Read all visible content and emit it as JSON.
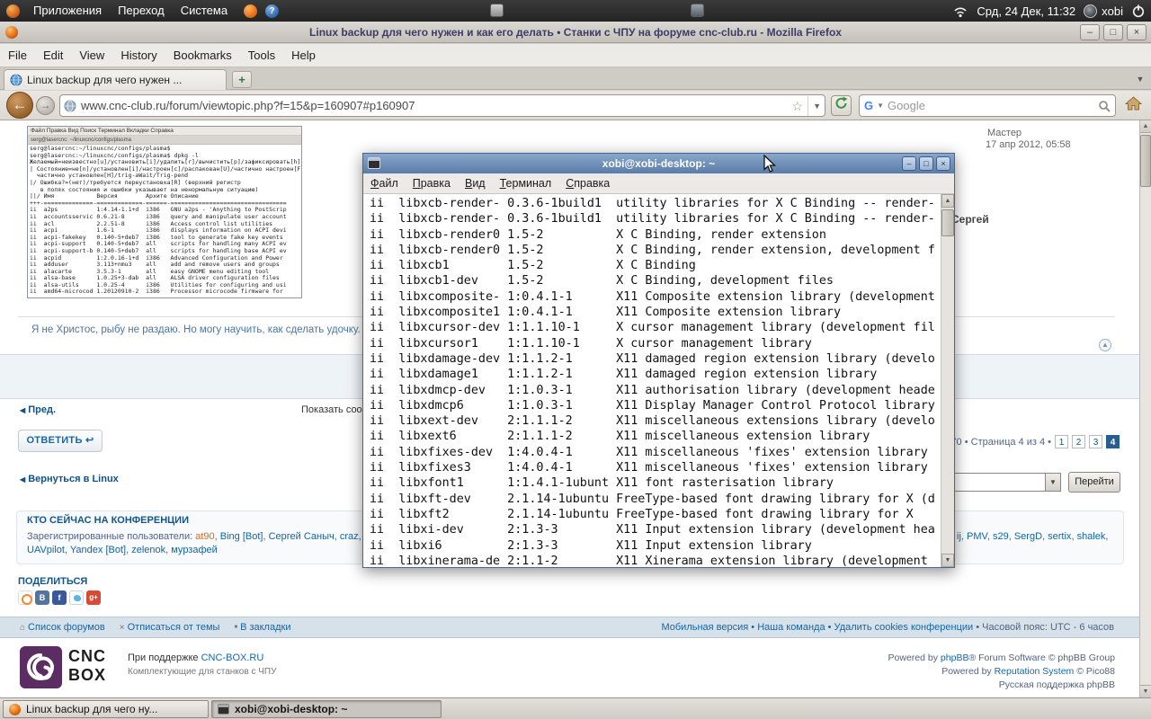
{
  "panel": {
    "menus": [
      "Приложения",
      "Переход",
      "Система"
    ],
    "clock": "Срд, 24 Дек, 11:32",
    "user": "xobi",
    "help_glyph": "?"
  },
  "firefox": {
    "title": "Linux backup для чего нужен и как его делать • Станки с ЧПУ на форуме cnc-club.ru - Mozilla Firefox",
    "menus": [
      "File",
      "Edit",
      "View",
      "History",
      "Bookmarks",
      "Tools",
      "Help"
    ],
    "tab_label": "Linux backup для чего нужен ...",
    "new_tab_glyph": "+",
    "url": "www.cnc-club.ru/forum/viewtopic.php?f=15&p=160907#p160907",
    "search_placeholder": "Google",
    "g_glyph": "G",
    "back_glyph": "←",
    "fwd_glyph": "→",
    "star_glyph": "☆",
    "home_glyph": "⌂",
    "btn_min": "–",
    "btn_max": "□",
    "btn_close": "×"
  },
  "terminal": {
    "title": "xobi@xobi-desktop: ~",
    "menus": [
      "Файл",
      "Правка",
      "Вид",
      "Терминал",
      "Справка"
    ],
    "btn_min": "–",
    "btn_max": "□",
    "btn_close": "×",
    "lines": [
      "ii  libxcb-render- 0.3.6-1build1  utility libraries for X C Binding -- render-",
      "ii  libxcb-render- 0.3.6-1build1  utility libraries for X C Binding -- render-",
      "ii  libxcb-render0 1.5-2          X C Binding, render extension",
      "ii  libxcb-render0 1.5-2          X C Binding, render extension, development f",
      "ii  libxcb1        1.5-2          X C Binding",
      "ii  libxcb1-dev    1.5-2          X C Binding, development files",
      "ii  libxcomposite- 1:0.4.1-1      X11 Composite extension library (development",
      "ii  libxcomposite1 1:0.4.1-1      X11 Composite extension library",
      "ii  libxcursor-dev 1:1.1.10-1     X cursor management library (development fil",
      "ii  libxcursor1    1:1.1.10-1     X cursor management library",
      "ii  libxdamage-dev 1:1.1.2-1      X11 damaged region extension library (develo",
      "ii  libxdamage1    1:1.1.2-1      X11 damaged region extension library",
      "ii  libxdmcp-dev   1:1.0.3-1      X11 authorisation library (development heade",
      "ii  libxdmcp6      1:1.0.3-1      X11 Display Manager Control Protocol library",
      "ii  libxext-dev    2:1.1.1-2      X11 miscellaneous extensions library (develo",
      "ii  libxext6       2:1.1.1-2      X11 miscellaneous extension library",
      "ii  libxfixes-dev  1:4.0.4-1      X11 miscellaneous 'fixes' extension library",
      "ii  libxfixes3     1:4.0.4-1      X11 miscellaneous 'fixes' extension library",
      "ii  libxfont1      1:1.4.1-1ubunt X11 font rasterisation library",
      "ii  libxft-dev     2.1.14-1ubuntu FreeType-based font drawing library for X (d",
      "ii  libxft2        2.1.14-1ubuntu FreeType-based font drawing library for X",
      "ii  libxi-dev      2:1.3-3        X11 Input extension library (development hea",
      "ii  libxi6         2:1.3-3        X11 Input extension library",
      "ii  libxinerama-de 2:1.1-2        X11 Xinerama extension library (development"
    ]
  },
  "post": {
    "rank": "Мастер",
    "date": "17 апр 2012, 05:58",
    "author": "Сергей",
    "signature": "Я не Христос, рыбу не раздаю. Но могу научить, как сделать удочку.",
    "top_glyph": "▲",
    "screenshot": {
      "menu": "Файл  Правка  Вид  Поиск  Терминал  Вкладки  Справка",
      "tab": "serg@lasercnc: ~/linuxcnc/configs/plasma",
      "lines": [
        "serg@lasercnc:~/linuxcnc/configs/plasma$",
        "serg@lasercnc:~/linuxcnc/configs/plasma$ dpkg -l",
        "Желаемый=неизвестно[u]/установить[i]/удалить[r]/вычистить[p]/зафиксировать[h]",
        "| Состояние=не[n]/установлен[i]/настроен[c]/распакован[U]/частично настроен[F]/",
        "  частично установлен[H]/trig-aWait/Trig-pend",
        "|/ Ошибка?=(нет)/требуется переустановка[R] (верхний регистр",
        "   в полях состояния и ошибки указывает на ненормальную ситуацию)",
        "||/ Имя            Версия        Архите Описание",
        "+++-==============-=============-======-=================================",
        "ii  a2ps           1:4.14-1.1+d  i386   GNU a2ps - 'Anything to PostScrip",
        "ii  accountsservic 0.6.21-8      i386   query and manipulate user account",
        "ii  acl            2.2.51-8      i386   Access control list utilities",
        "ii  acpi           1.6-1         i386   displays information on ACPI devi",
        "ii  acpi-fakekey   0.140-5+deb7  i386   tool to generate fake key events",
        "ii  acpi-support   0.140-5+deb7  all    scripts for handling many ACPI ev",
        "ii  acpi-support-b 0.140-5+deb7  all    scripts for handling base ACPI ev",
        "ii  acpid          1:2.0.16-1+d  i386   Advanced Configuration and Power",
        "ii  adduser        3.113+nmu3    all    add and remove users and groups",
        "ii  alacarte       3.5.3-1       all    easy GNOME menu editing tool",
        "ii  alsa-base      1.0.25+3-dab  all    ALSA driver configuration files",
        "ii  alsa-utils     1.0.25-4      i386   Utilities for configuring and usi",
        "ii  amd64-microcod 1.20120910-2  i386   Processor microcode firmware for"
      ]
    }
  },
  "pagebar": {
    "prev_glyph": "◀",
    "prev": "Пред.",
    "display_posts": "Показать сообщения за:",
    "reply": "ОТВЕТИТЬ ↩",
    "pag_info": "70 • Страница 4 из 4 •",
    "pages": [
      {
        "t": "1"
      },
      {
        "t": "2"
      },
      {
        "t": "3"
      },
      {
        "t": "4",
        "cls": "cur"
      }
    ],
    "return_glyph": "◀",
    "return_to": "Вернуться в Linux",
    "jump_arrow": "▼",
    "go": "Перейти"
  },
  "who": {
    "title": "КТО СЕЙЧАС НА КОНФЕРЕНЦИИ",
    "prefix": "Зарегистрированные пользователи: ",
    "left": [
      {
        "t": "at90",
        "c": "#cc6e1f"
      },
      {
        "t": "Bing [Bot]",
        "c": "#1166a5"
      },
      {
        "t": "Сергей Саныч",
        "c": "#1166a5"
      },
      {
        "t": "craz,",
        "c": "#1166a5"
      }
    ],
    "right": [
      {
        "t": "ij",
        "c": "#1166a5"
      },
      {
        "t": "PMV",
        "c": "#1166a5"
      },
      {
        "t": "s29",
        "c": "#1166a5"
      },
      {
        "t": "SergD",
        "c": "#1166a5"
      },
      {
        "t": "sertix",
        "c": "#1166a5"
      },
      {
        "t": "shalek,",
        "c": "#1166a5"
      }
    ],
    "line2": [
      {
        "t": "UAVpilot",
        "c": "#1166a5"
      },
      {
        "t": "Yandex [Bot]",
        "c": "#1166a5"
      },
      {
        "t": "zelenok",
        "c": "#1166a5"
      },
      {
        "t": "мурзафей",
        "c": "#1166a5"
      }
    ]
  },
  "share": {
    "title": "ПОДЕЛИТЬСЯ",
    "vk": "В",
    "fb": "f",
    "gp": "g+"
  },
  "bottombar": {
    "items": [
      "Список форумов",
      "Отписаться от темы",
      "В закладки"
    ],
    "icons": [
      "⌂",
      "×",
      "■"
    ],
    "links": "Мобильная версия • Наша команда • Удалить cookies конференции",
    "tz": " • Часовой пояс: UTC - 6 часов"
  },
  "footer": {
    "logo_line1": "CNC",
    "logo_line2": "BOX",
    "sponsor_pre": "При поддержке ",
    "sponsor_link": "CNC-BOX.RU",
    "sponsor_sub": "Комплектующие для станков с ЧПУ",
    "p1_pre": "Powered by ",
    "p1_link": "phpBB",
    "p1_post": "® Forum Software © phpBB Group",
    "p2_pre": "Powered by ",
    "p2_link": "Reputation System",
    "p2_post": " © Pico88",
    "p3": "Русская поддержка phpBB"
  },
  "taskbar": {
    "item1": "Linux backup для чего ну...",
    "item2": "xobi@xobi-desktop: ~"
  }
}
